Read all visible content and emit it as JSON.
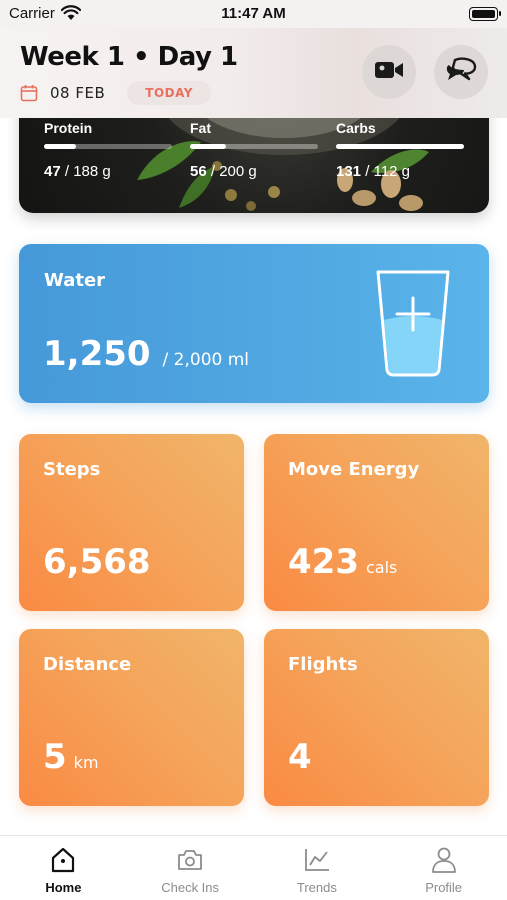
{
  "status_bar": {
    "carrier": "Carrier",
    "time": "11:47 AM",
    "wifi_icon": "wifi-icon",
    "battery_icon": "battery-icon"
  },
  "header": {
    "title": "Week 1 • Day 1",
    "date": "08 FEB",
    "today_label": "TODAY",
    "calendar_icon": "calendar-icon",
    "video_icon": "video-camera-icon",
    "chat_icon": "chat-bubbles-icon"
  },
  "macros": [
    {
      "label": "Protein",
      "current": "47",
      "goal": "188 g",
      "progress": 0.25
    },
    {
      "label": "Fat",
      "current": "56",
      "goal": "200 g",
      "progress": 0.28
    },
    {
      "label": "Carbs",
      "current": "131",
      "goal": "112 g",
      "progress": 1.0
    }
  ],
  "water": {
    "title": "Water",
    "value": "1,250",
    "goal": "/ 2,000 ml",
    "icon": "water-glass-add-icon"
  },
  "activity": {
    "steps": {
      "title": "Steps",
      "value": "6,568",
      "unit": ""
    },
    "move_energy": {
      "title": "Move Energy",
      "value": "423",
      "unit": "cals"
    },
    "distance": {
      "title": "Distance",
      "value": "5",
      "unit": "km"
    },
    "flights": {
      "title": "Flights",
      "value": "4",
      "unit": ""
    }
  },
  "tabs": [
    {
      "label": "Home",
      "icon": "home-icon",
      "active": true
    },
    {
      "label": "Check Ins",
      "icon": "camera-icon",
      "active": false
    },
    {
      "label": "Trends",
      "icon": "trends-chart-icon",
      "active": false
    },
    {
      "label": "Profile",
      "icon": "profile-icon",
      "active": false
    }
  ],
  "colors": {
    "water_card": "#4fa6e0",
    "activity_card": "#f59b52",
    "today_badge_text": "#e8705f"
  }
}
